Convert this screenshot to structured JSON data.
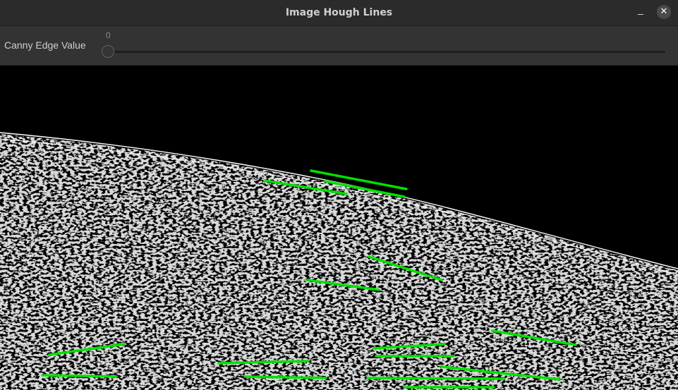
{
  "window": {
    "title": "Image Hough Lines"
  },
  "titlebar": {
    "minimize_icon": "minimize-icon",
    "close_icon": "close-icon",
    "close_glyph": "✕"
  },
  "toolbar": {
    "slider_label": "Canny Edge Value",
    "slider_value": "0",
    "slider_min": 0
  },
  "canvas": {
    "description_colors": {
      "background": "#000000",
      "edges": "#ffffff",
      "hough_lines": "#00e000"
    }
  }
}
